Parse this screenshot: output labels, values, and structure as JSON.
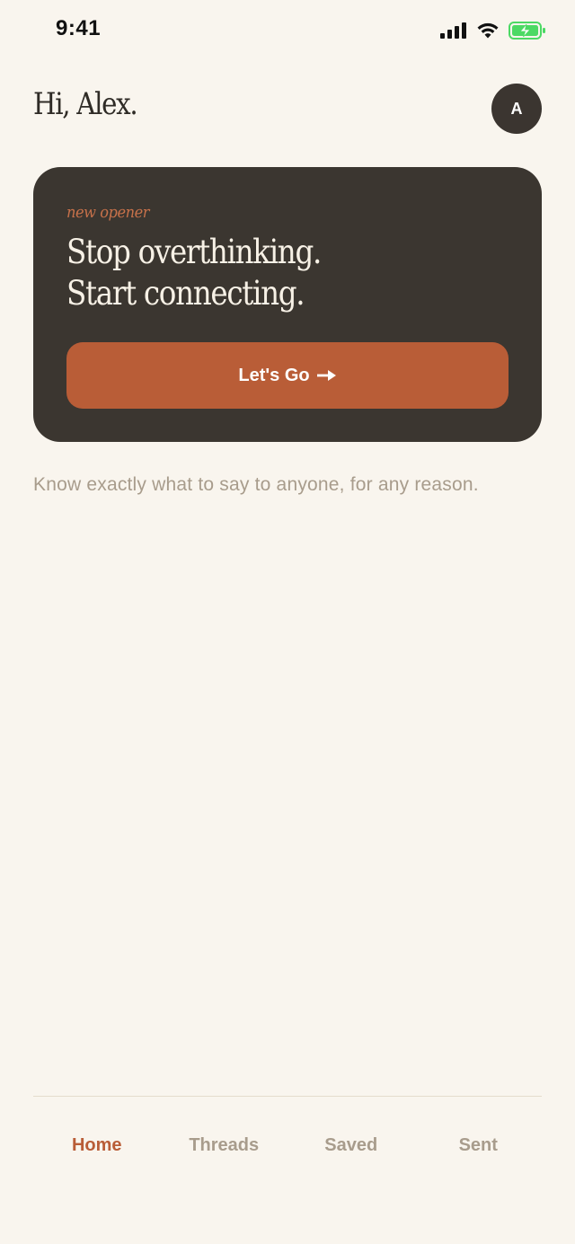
{
  "status_bar": {
    "time": "9:41"
  },
  "header": {
    "greeting": "Hi, Alex.",
    "avatar_initial": "A"
  },
  "hero": {
    "eyebrow": "new opener",
    "headline_line1": "Stop overthinking.",
    "headline_line2": "Start connecting.",
    "cta_label": "Let's Go"
  },
  "tagline": "Know exactly what to say to anyone, for any reason.",
  "tabs": [
    {
      "label": "Home",
      "active": true
    },
    {
      "label": "Threads",
      "active": false
    },
    {
      "label": "Saved",
      "active": false
    },
    {
      "label": "Sent",
      "active": false
    }
  ],
  "colors": {
    "background": "#f9f5ee",
    "card": "#3b3630",
    "accent": "#b95d37",
    "muted_text": "#a89c8c",
    "battery_green": "#4cd964"
  },
  "icons": [
    "cellular-signal-icon",
    "wifi-icon",
    "battery-charging-icon",
    "arrow-right-icon"
  ]
}
